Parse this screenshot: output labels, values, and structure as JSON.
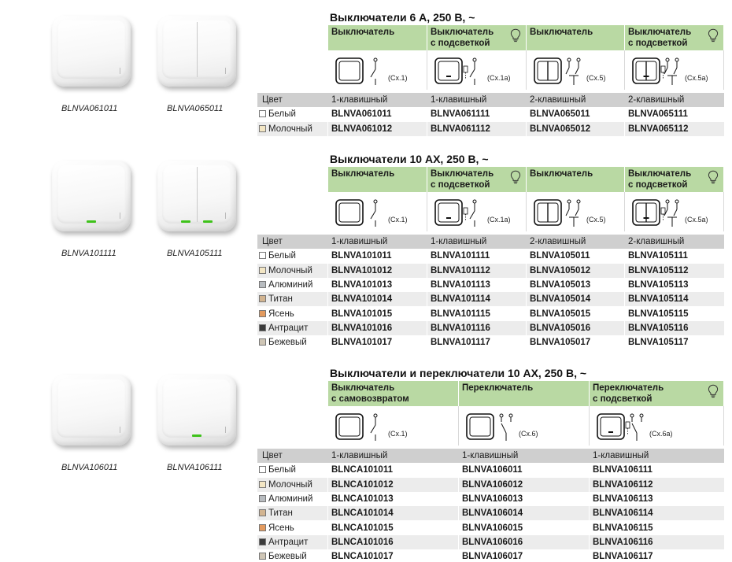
{
  "sections": [
    {
      "title": "Выключатели 6 А, 250 В, ~",
      "photos": [
        {
          "label": "BLNVA061011",
          "type": "single",
          "led": false
        },
        {
          "label": "BLNVA065011",
          "type": "double",
          "led": false
        }
      ],
      "columns": [
        {
          "header": "Выключатель",
          "bulb": false,
          "scheme": "Сх.1",
          "scheme_type": "single"
        },
        {
          "header": "Выключатель\nс подсветкой",
          "bulb": true,
          "scheme": "Сх.1а",
          "scheme_type": "single-lit"
        },
        {
          "header": "Выключатель",
          "bulb": false,
          "scheme": "Сх.5",
          "scheme_type": "double"
        },
        {
          "header": "Выключатель\nс подсветкой",
          "bulb": true,
          "scheme": "Сх.5а",
          "scheme_type": "double-lit"
        }
      ],
      "color_header": "Цвет",
      "keys_row": [
        "1-клавишный",
        "1-клавишный",
        "2-клавишный",
        "2-клавишный"
      ],
      "rows": [
        {
          "color": "Белый",
          "swatch": "#ffffff",
          "codes": [
            "BLNVA061011",
            "BLNVA061111",
            "BLNVA065011",
            "BLNVA065111"
          ]
        },
        {
          "color": "Молочный",
          "swatch": "#f3e6c4",
          "codes": [
            "BLNVA061012",
            "BLNVA061112",
            "BLNVA065012",
            "BLNVA065112"
          ]
        }
      ]
    },
    {
      "title": "Выключатели 10 АХ, 250 В, ~",
      "photos": [
        {
          "label": "BLNVA101111",
          "type": "single",
          "led": true
        },
        {
          "label": "BLNVA105111",
          "type": "double",
          "led": true
        }
      ],
      "columns": [
        {
          "header": "Выключатель",
          "bulb": false,
          "scheme": "Сх.1",
          "scheme_type": "single"
        },
        {
          "header": "Выключатель\nс подсветкой",
          "bulb": true,
          "scheme": "Сх.1а",
          "scheme_type": "single-lit"
        },
        {
          "header": "Выключатель",
          "bulb": false,
          "scheme": "Сх.5",
          "scheme_type": "double"
        },
        {
          "header": "Выключатель\nс подсветкой",
          "bulb": true,
          "scheme": "Сх.5а",
          "scheme_type": "double-lit"
        }
      ],
      "color_header": "Цвет",
      "keys_row": [
        "1-клавишный",
        "1-клавишный",
        "2-клавишный",
        "2-клавишный"
      ],
      "rows": [
        {
          "color": "Белый",
          "swatch": "#ffffff",
          "codes": [
            "BLNVA101011",
            "BLNVA101111",
            "BLNVA105011",
            "BLNVA105111"
          ]
        },
        {
          "color": "Молочный",
          "swatch": "#f3e6c4",
          "codes": [
            "BLNVA101012",
            "BLNVA101112",
            "BLNVA105012",
            "BLNVA105112"
          ]
        },
        {
          "color": "Алюминий",
          "swatch": "#b8bcc0",
          "codes": [
            "BLNVA101013",
            "BLNVA101113",
            "BLNVA105013",
            "BLNVA105113"
          ]
        },
        {
          "color": "Титан",
          "swatch": "#d2b490",
          "codes": [
            "BLNVA101014",
            "BLNVA101114",
            "BLNVA105014",
            "BLNVA105114"
          ]
        },
        {
          "color": "Ясень",
          "swatch": "#e39a5e",
          "codes": [
            "BLNVA101015",
            "BLNVA101115",
            "BLNVA105015",
            "BLNVA105115"
          ]
        },
        {
          "color": "Антрацит",
          "swatch": "#3a3a3a",
          "codes": [
            "BLNVA101016",
            "BLNVA101116",
            "BLNVA105016",
            "BLNVA105116"
          ]
        },
        {
          "color": "Бежевый",
          "swatch": "#cfc6b6",
          "codes": [
            "BLNVA101017",
            "BLNVA101117",
            "BLNVA105017",
            "BLNVA105117"
          ]
        }
      ]
    },
    {
      "title": "Выключатели и переключатели 10 АХ, 250 В, ~",
      "photos": [
        {
          "label": "BLNVA106011",
          "type": "single",
          "led": false
        },
        {
          "label": "BLNVA106111",
          "type": "single",
          "led": true
        }
      ],
      "columns": [
        {
          "header": "Выключатель\nс самовозвратом",
          "bulb": false,
          "scheme": "Сх.1",
          "scheme_type": "single"
        },
        {
          "header": "Переключатель",
          "bulb": false,
          "scheme": "Сх.6",
          "scheme_type": "changeover"
        },
        {
          "header": "Переключатель\nс подсветкой",
          "bulb": true,
          "scheme": "Сх.6а",
          "scheme_type": "changeover-lit"
        }
      ],
      "color_header": "Цвет",
      "keys_row": [
        "1-клавишный",
        "1-клавишный",
        "1-клавишный"
      ],
      "rows": [
        {
          "color": "Белый",
          "swatch": "#ffffff",
          "codes": [
            "BLNCA101011",
            "BLNVA106011",
            "BLNVA106111"
          ]
        },
        {
          "color": "Молочный",
          "swatch": "#f3e6c4",
          "codes": [
            "BLNCA101012",
            "BLNVA106012",
            "BLNVA106112"
          ]
        },
        {
          "color": "Алюминий",
          "swatch": "#b8bcc0",
          "codes": [
            "BLNCA101013",
            "BLNVA106013",
            "BLNVA106113"
          ]
        },
        {
          "color": "Титан",
          "swatch": "#d2b490",
          "codes": [
            "BLNCA101014",
            "BLNVA106014",
            "BLNVA106114"
          ]
        },
        {
          "color": "Ясень",
          "swatch": "#e39a5e",
          "codes": [
            "BLNCA101015",
            "BLNVA106015",
            "BLNVA106115"
          ]
        },
        {
          "color": "Антрацит",
          "swatch": "#3a3a3a",
          "codes": [
            "BLNCA101016",
            "BLNVA106016",
            "BLNVA106116"
          ]
        },
        {
          "color": "Бежевый",
          "swatch": "#cfc6b6",
          "codes": [
            "BLNCA101017",
            "BLNVA106017",
            "BLNVA106117"
          ]
        }
      ]
    }
  ]
}
